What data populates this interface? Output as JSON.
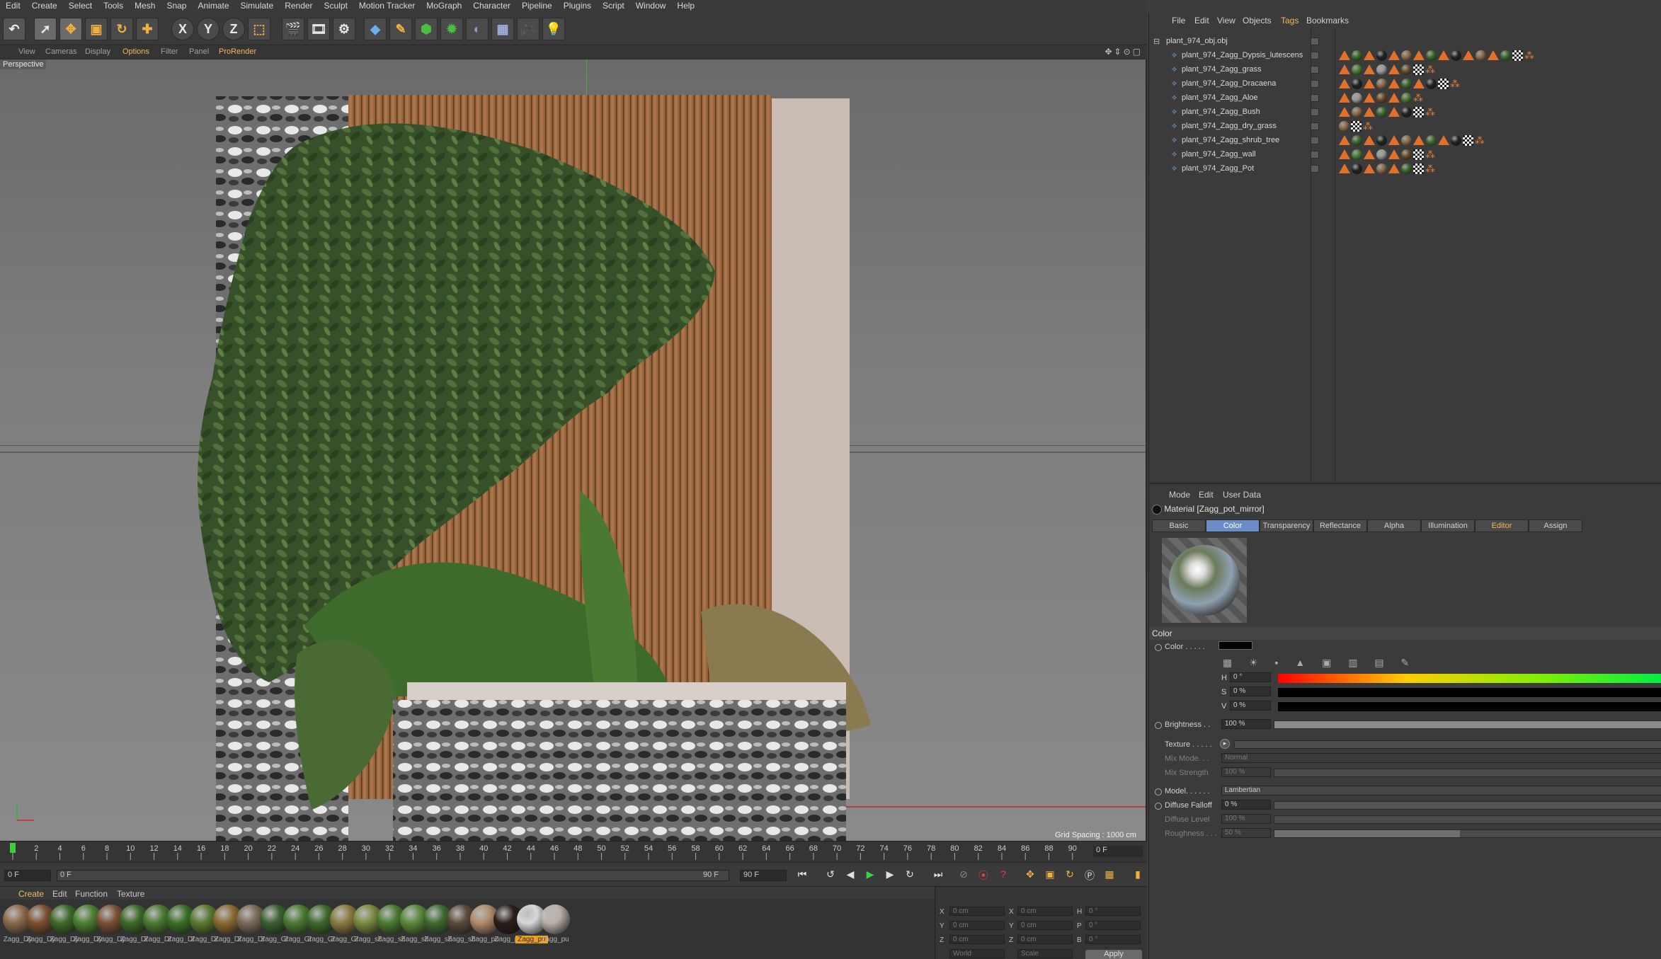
{
  "menu": [
    "Edit",
    "Create",
    "Select",
    "Tools",
    "Mesh",
    "Snap",
    "Animate",
    "Simulate",
    "Render",
    "Sculpt",
    "Motion Tracker",
    "MoGraph",
    "Character",
    "Pipeline",
    "Plugins",
    "Script",
    "Window",
    "Help"
  ],
  "toolbar": {
    "axis_x": "X",
    "axis_y": "Y",
    "axis_z": "Z"
  },
  "viewport_menu": [
    "View",
    "Cameras",
    "Display",
    "Options",
    "Filter",
    "Panel",
    "ProRender"
  ],
  "viewport": {
    "label": "Perspective",
    "grid_spacing": "Grid Spacing : 1000 cm",
    "highlight_menu": "Options"
  },
  "timeline": {
    "ticks": [
      "0",
      "2",
      "4",
      "6",
      "8",
      "10",
      "12",
      "14",
      "16",
      "18",
      "20",
      "22",
      "24",
      "26",
      "28",
      "30",
      "32",
      "34",
      "36",
      "38",
      "40",
      "42",
      "44",
      "46",
      "48",
      "50",
      "52",
      "54",
      "56",
      "58",
      "60",
      "62",
      "64",
      "66",
      "68",
      "70",
      "72",
      "74",
      "76",
      "78",
      "80",
      "82",
      "84",
      "86",
      "88",
      "90"
    ],
    "current_frame": "0 F"
  },
  "transport": {
    "start": "0 F",
    "range_start": "0 F",
    "range_end": "90 F",
    "end": "90 F"
  },
  "material_menu": [
    "Create",
    "Edit",
    "Function",
    "Texture"
  ],
  "materials": [
    {
      "name": "Zagg_Dy",
      "color": "#8a6a4a"
    },
    {
      "name": "Zagg_Dy",
      "color": "#7a5030"
    },
    {
      "name": "Zagg_Dy",
      "color": "#3e6a2a"
    },
    {
      "name": "Zagg_Dy",
      "color": "#4a8030"
    },
    {
      "name": "Zagg_Dy",
      "color": "#7a5034"
    },
    {
      "name": "Zagg_Dr",
      "color": "#3a6a28"
    },
    {
      "name": "Zagg_Dr",
      "color": "#4a7a30"
    },
    {
      "name": "Zagg_Dr",
      "color": "#3a7028"
    },
    {
      "name": "Zagg_Dr",
      "color": "#5a7a30"
    },
    {
      "name": "Zagg_Dr",
      "color": "#8a6a30"
    },
    {
      "name": "Zagg_Dr",
      "color": "#7a6a58"
    },
    {
      "name": "Zagg_Gr",
      "color": "#3a6030"
    },
    {
      "name": "Zagg_Gr",
      "color": "#4a7a32"
    },
    {
      "name": "Zagg_Gr",
      "color": "#3c6a2a"
    },
    {
      "name": "Zagg_Gr",
      "color": "#8a7a40"
    },
    {
      "name": "Zagg_sh",
      "color": "#7a8a40"
    },
    {
      "name": "Zagg_sh",
      "color": "#4a7a32"
    },
    {
      "name": "Zagg_sh",
      "color": "#5a8a38"
    },
    {
      "name": "Zagg_sh",
      "color": "#3e6a30"
    },
    {
      "name": "Zagg_sh",
      "color": "#5a4a3a"
    },
    {
      "name": "Zagg_pu",
      "color": "#b08a6a"
    },
    {
      "name": "Zagg_pu",
      "color": "#2a1e1a"
    },
    {
      "name": "Zagg_pu",
      "color": "#d8d8d8"
    },
    {
      "name": "Zagg_pu",
      "color": "#b8b0a8"
    }
  ],
  "coords": {
    "x": "X",
    "y": "Y",
    "z": "Z",
    "h": "H",
    "p": "P",
    "b": "B",
    "val_cm": "0 cm",
    "val_deg": "0 °",
    "world": "World",
    "scale": "Scale",
    "apply": "Apply"
  },
  "object_manager": {
    "menu": [
      "File",
      "Edit",
      "View",
      "Objects",
      "Tags",
      "Bookmarks"
    ],
    "highlight": "Tags",
    "root": "plant_974_obj.obj",
    "objects": [
      "plant_974_Zagg_Dypsis_lutescens",
      "plant_974_Zagg_grass",
      "plant_974_Zagg_Dracaena",
      "plant_974_Zagg_Aloe",
      "plant_974_Zagg_Bush",
      "plant_974_Zagg_dry_grass",
      "plant_974_Zagg_shrub_tree",
      "plant_974_Zagg_wall",
      "plant_974_Zagg_Pot"
    ]
  },
  "attribute_manager": {
    "menu": [
      "Mode",
      "Edit",
      "User Data"
    ],
    "title": "Material [Zagg_pot_mirror]",
    "tabs": [
      "Basic",
      "Color",
      "Transparency",
      "Reflectance",
      "Alpha",
      "Illumination",
      "Editor",
      "Assign"
    ],
    "active_tab": "Color",
    "section": "Color",
    "color_label": "Color . . . . .",
    "color_value": "#000000",
    "h_label": "H",
    "h_value": "0 °",
    "s_label": "S",
    "s_value": "0 %",
    "v_label": "V",
    "v_value": "0 %",
    "brightness_label": "Brightness . .",
    "brightness_value": "100 %",
    "texture_label": "Texture . . . . .",
    "mixmode_label": "Mix Mode. . .",
    "mixmode_value": "Normal",
    "mixstrength_label": "Mix Strength",
    "mixstrength_value": "100 %",
    "model_label": "Model. . . . . .",
    "model_value": "Lambertian",
    "falloff_label": "Diffuse Falloff",
    "falloff_value": "0 %",
    "level_label": "Diffuse Level",
    "level_value": "100 %",
    "rough_label": "Roughness . . .",
    "rough_value": "50 %"
  }
}
